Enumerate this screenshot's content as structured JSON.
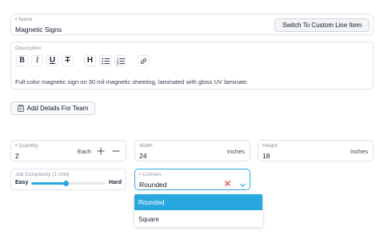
{
  "name_field": {
    "label": "Name",
    "value": "Magnetic Signs"
  },
  "switch_button": {
    "label": "Switch To Custom Line Item"
  },
  "description": {
    "label": "Description",
    "text": "Full-color magnetic sign on 30 mil magnetic sheeting, laminated with gloss UV laminate.",
    "toolbar": [
      "bold-icon",
      "italic-icon",
      "underline-icon",
      "strikethrough-icon",
      "heading-icon",
      "bullet-list-icon",
      "numbered-list-icon",
      "link-icon"
    ]
  },
  "add_details_button": {
    "label": "Add Details For Team"
  },
  "quantity": {
    "label": "Quantity",
    "value": "2",
    "unit": "Each"
  },
  "width": {
    "label": "Width",
    "value": "24",
    "unit": "Inches"
  },
  "height": {
    "label": "Height",
    "value": "18",
    "unit": "Inches"
  },
  "complexity": {
    "label": "Job Complexity (1 Unit)",
    "min_label": "Easy",
    "max_label": "Hard",
    "level": 0.47
  },
  "corners": {
    "label": "Corners",
    "value": "Rounded",
    "options": [
      "Rounded",
      "Square"
    ],
    "selected_index": 0
  },
  "colors": {
    "accent": "#29a8e0",
    "required": "#e5484d",
    "clear": "#e5484d"
  }
}
